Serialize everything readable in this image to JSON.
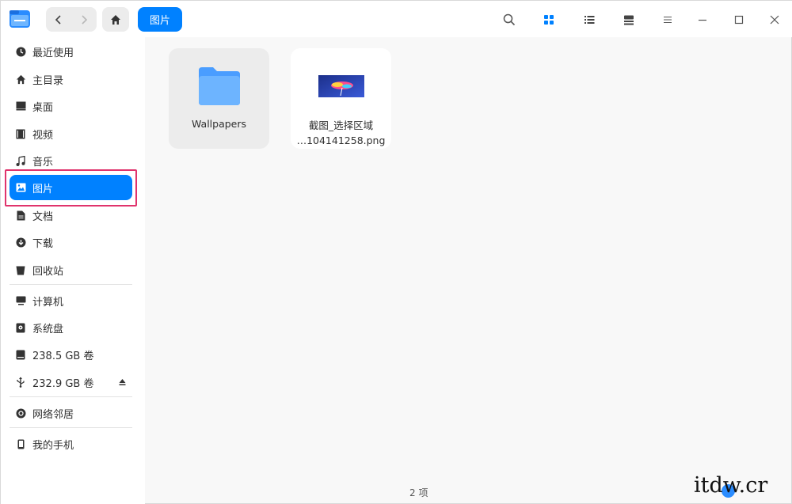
{
  "window": {
    "breadcrumb": "图片"
  },
  "toolbar": {
    "icons": [
      "search-icon",
      "icon-view-icon",
      "list-view-icon",
      "detail-view-icon",
      "menu-icon",
      "minimize-icon",
      "maximize-icon",
      "close-icon"
    ]
  },
  "sidebar": {
    "items": [
      {
        "label": "最近使用",
        "icon": "clock-icon"
      },
      {
        "label": "主目录",
        "icon": "home-icon"
      },
      {
        "label": "桌面",
        "icon": "desktop-icon"
      },
      {
        "label": "视频",
        "icon": "video-icon"
      },
      {
        "label": "音乐",
        "icon": "music-icon"
      },
      {
        "label": "图片",
        "icon": "picture-icon",
        "active": true
      },
      {
        "label": "文档",
        "icon": "document-icon"
      },
      {
        "label": "下载",
        "icon": "download-icon"
      },
      {
        "label": "回收站",
        "icon": "trash-icon"
      },
      {
        "label": "计算机",
        "icon": "computer-icon"
      },
      {
        "label": "系统盘",
        "icon": "system-disk-icon"
      },
      {
        "label": "238.5 GB 卷",
        "icon": "disk-icon"
      },
      {
        "label": "232.9 GB 卷",
        "icon": "usb-icon"
      },
      {
        "label": "网络邻居",
        "icon": "network-icon"
      },
      {
        "label": "我的手机",
        "icon": "phone-icon"
      }
    ]
  },
  "files": [
    {
      "name": "Wallpapers",
      "type": "folder"
    },
    {
      "name_line1": "截图_选择区域",
      "name_line2": "…104141258.png",
      "type": "image"
    }
  ],
  "status": {
    "count": "2 项"
  },
  "watermark": {
    "text": "itdw.cr"
  },
  "colors": {
    "accent": "#0081ff",
    "highlight": "#e0336c"
  }
}
